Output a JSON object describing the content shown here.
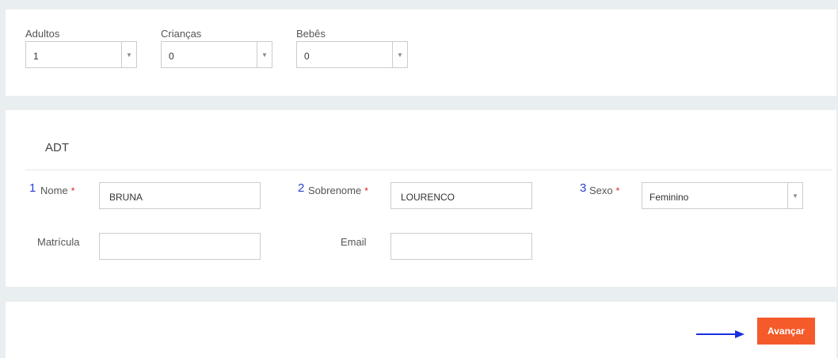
{
  "passengers": {
    "adults": {
      "label": "Adultos",
      "value": "1"
    },
    "children": {
      "label": "Crianças",
      "value": "0"
    },
    "infants": {
      "label": "Bebês",
      "value": "0"
    }
  },
  "traveler": {
    "section_title": "ADT",
    "name": {
      "number": "1",
      "label": "Nome",
      "required_mark": "*",
      "value": "BRUNA"
    },
    "surname": {
      "number": "2",
      "label": "Sobrenome",
      "required_mark": "*",
      "value": "LOURENCO"
    },
    "sex": {
      "number": "3",
      "label": "Sexo",
      "required_mark": "*",
      "value": "Feminino"
    },
    "registration": {
      "label": "Matrícula",
      "value": ""
    },
    "email": {
      "label": "Email",
      "value": ""
    }
  },
  "footer": {
    "next_label": "Avançar"
  },
  "colors": {
    "accent": "#f45a2a",
    "annotation": "#2b3fd1",
    "required": "#e02020"
  }
}
